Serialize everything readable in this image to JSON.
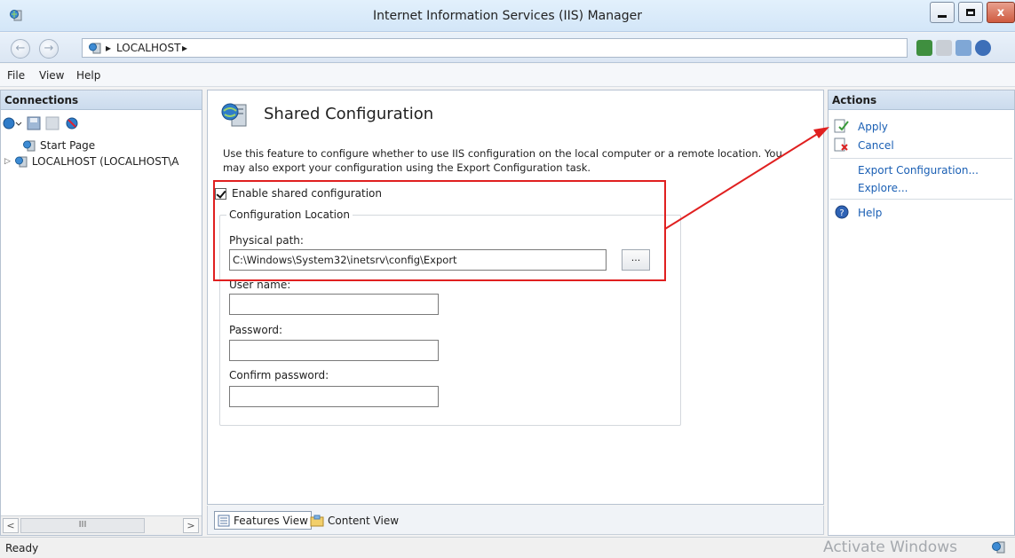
{
  "window": {
    "title": "Internet Information Services (IIS) Manager"
  },
  "address": {
    "crumbs": [
      "LOCALHOST"
    ]
  },
  "menu": {
    "items": [
      "File",
      "View",
      "Help"
    ]
  },
  "connections": {
    "header": "Connections",
    "tree": [
      {
        "label": "Start Page"
      },
      {
        "label": "LOCALHOST (LOCALHOST\\A"
      }
    ],
    "scroll_thumb": "III"
  },
  "main": {
    "title": "Shared Configuration",
    "description": "Use this feature to configure whether to use IIS configuration on the local computer or a remote location. You may also export your configuration using the Export Configuration task.",
    "enable_label": "Enable shared configuration",
    "enable_checked": true,
    "group_label": "Configuration Location",
    "physical_path_label": "Physical path:",
    "physical_path_value": "C:\\Windows\\System32\\inetsrv\\config\\Export",
    "browse_label": "...",
    "user_name_label": "User name:",
    "user_name_value": "",
    "password_label": "Password:",
    "password_value": "",
    "confirm_password_label": "Confirm password:",
    "confirm_password_value": ""
  },
  "view_tabs": {
    "features": "Features View",
    "content": "Content View"
  },
  "actions": {
    "header": "Actions",
    "apply": "Apply",
    "cancel": "Cancel",
    "export": "Export Configuration...",
    "explore": "Explore...",
    "help": "Help"
  },
  "status": {
    "text": "Ready",
    "watermark": "Activate Windows"
  },
  "colors": {
    "accent": "#1a5fb4",
    "highlight": "#e02020",
    "pane_header": "#cbdbed"
  }
}
